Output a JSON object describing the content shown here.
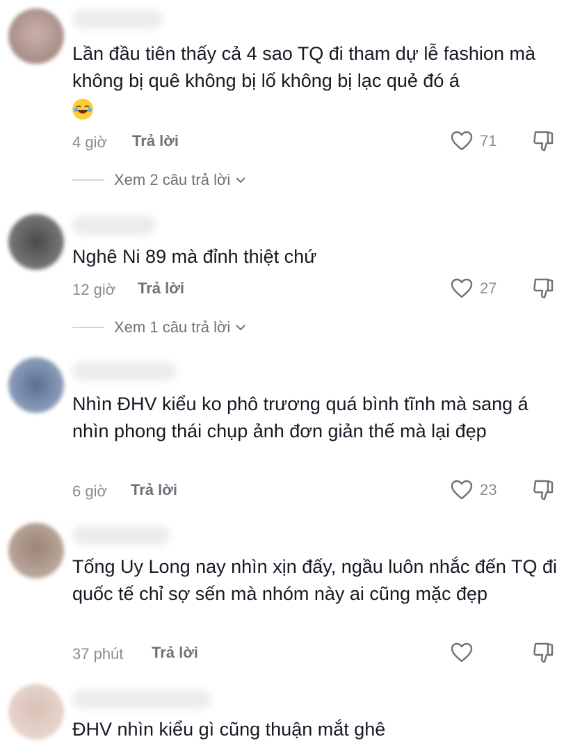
{
  "comments": [
    {
      "text": "Lần đầu tiên thấy cả 4 sao TQ đi tham dự lễ fashion mà không bị quê không bị lố không bị lạc quẻ đó á",
      "emoji": "😂",
      "time": "4 giờ",
      "reply_label": "Trả lời",
      "likes": "71",
      "view_replies": "Xem 2 câu trả lời"
    },
    {
      "text": "Nghê Ni 89 mà đỉnh thiệt chứ",
      "time": "12 giờ",
      "reply_label": "Trả lời",
      "likes": "27",
      "view_replies": "Xem 1 câu trả lời"
    },
    {
      "text": "Nhìn ĐHV kiểu ko phô trương quá bình tĩnh mà sang á nhìn phong thái chụp ảnh đơn giản thế mà lại đẹp",
      "time": "6 giờ",
      "reply_label": "Trả lời",
      "likes": "23"
    },
    {
      "text": "Tống Uy Long nay nhìn xịn đấy, ngầu luôn nhắc đến TQ đi quốc tế chỉ sợ sến mà nhóm này ai cũng mặc đẹp",
      "time": "37 phút",
      "reply_label": "Trả lời",
      "likes": ""
    },
    {
      "text": "ĐHV nhìn kiểu gì cũng thuận mắt ghê"
    }
  ],
  "icons": {
    "like": "heart-outline-icon",
    "dislike": "thumbs-down-icon",
    "expand": "chevron-down-icon"
  },
  "colors": {
    "text": "#161823",
    "muted": "#8a8b91"
  }
}
